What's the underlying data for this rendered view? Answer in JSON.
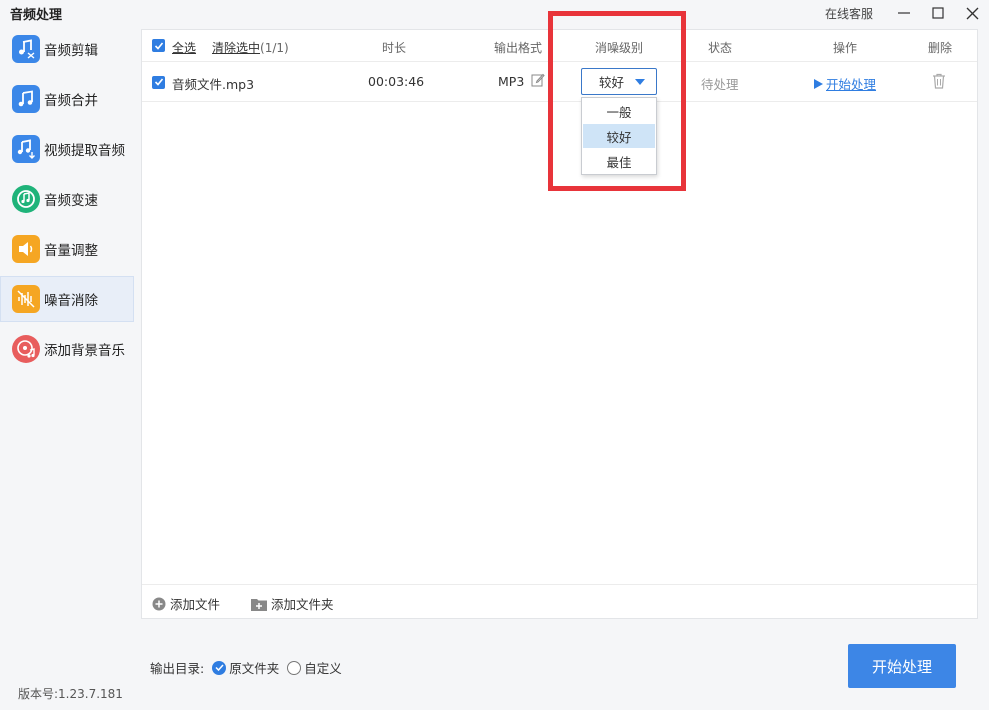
{
  "app": {
    "title": "音频处理",
    "online_service": "在线客服"
  },
  "sidebar": {
    "items": [
      {
        "label": "音频剪辑",
        "icon": "music-scissors-icon",
        "color": "#3b87e8"
      },
      {
        "label": "音频合并",
        "icon": "music-note-icon",
        "color": "#3b87e8"
      },
      {
        "label": "视频提取音频",
        "icon": "music-download-icon",
        "color": "#3b87e8"
      },
      {
        "label": "音频变速",
        "icon": "speed-gauge-icon",
        "color": "#1fb37a"
      },
      {
        "label": "音量调整",
        "icon": "speaker-icon",
        "color": "#f5a623"
      },
      {
        "label": "噪音消除",
        "icon": "noise-wave-icon",
        "color": "#f5a623",
        "active": true
      },
      {
        "label": "添加背景音乐",
        "icon": "disc-music-icon",
        "color": "#e85d5d"
      }
    ]
  },
  "table": {
    "select_all": "全选",
    "clear_selected": "清除选中",
    "selected_count": "(1/1)",
    "headers": {
      "duration": "时长",
      "format": "输出格式",
      "level": "消噪级别",
      "status": "状态",
      "action": "操作",
      "delete": "删除"
    },
    "rows": [
      {
        "name": "音频文件.mp3",
        "duration": "00:03:46",
        "format": "MP3",
        "level": "较好",
        "status": "待处理",
        "action": "开始处理"
      }
    ]
  },
  "dropdown": {
    "options": [
      "一般",
      "较好",
      "最佳"
    ],
    "selected": "较好"
  },
  "bottom": {
    "add_file": "添加文件",
    "add_folder": "添加文件夹"
  },
  "output": {
    "label": "输出目录:",
    "original": "原文件夹",
    "custom": "自定义"
  },
  "start_button": "开始处理",
  "version": "版本号:1.23.7.181",
  "colors": {
    "accent": "#2f7de1",
    "highlight": "#e8343a",
    "start_button": "#3d86e6"
  }
}
